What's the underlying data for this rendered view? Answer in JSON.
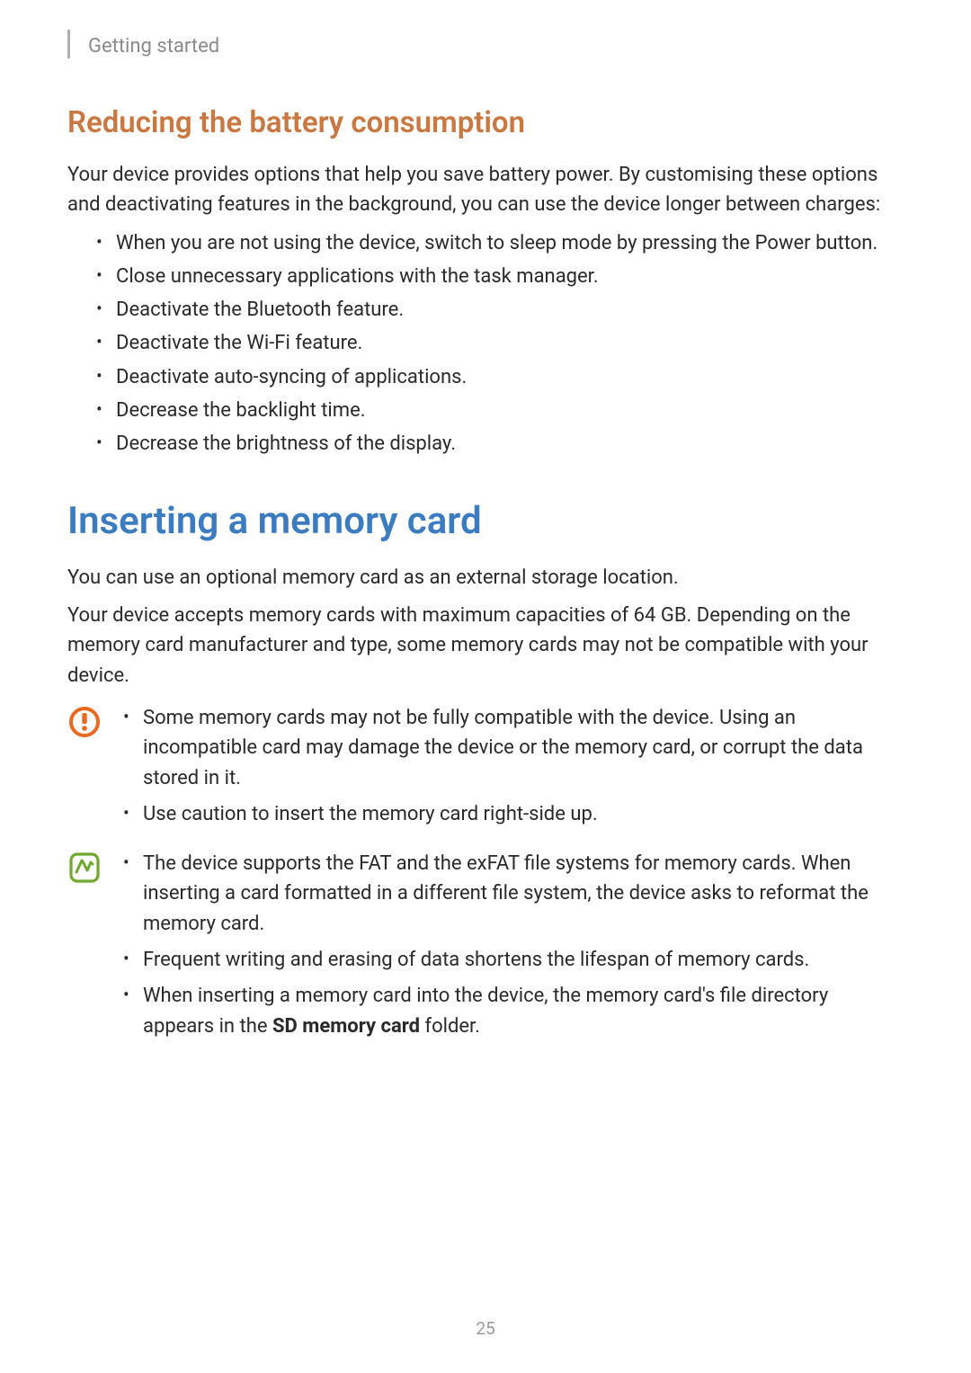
{
  "header": {
    "breadcrumb": "Getting started"
  },
  "section1": {
    "heading": "Reducing the battery consumption",
    "intro": "Your device provides options that help you save battery power. By customising these options and deactivating features in the background, you can use the device longer between charges:",
    "bullets": [
      "When you are not using the device, switch to sleep mode by pressing the Power button.",
      "Close unnecessary applications with the task manager.",
      "Deactivate the Bluetooth feature.",
      "Deactivate the Wi-Fi feature.",
      "Deactivate auto-syncing of applications.",
      "Decrease the backlight time.",
      "Decrease the brightness of the display."
    ]
  },
  "section2": {
    "heading": "Inserting a memory card",
    "p1": "You can use an optional memory card as an external storage location.",
    "p2": "Your device accepts memory cards with maximum capacities of 64 GB. Depending on the memory card manufacturer and type, some memory cards may not be compatible with your device.",
    "warning": {
      "bullets": [
        "Some memory cards may not be fully compatible with the device. Using an incompatible card may damage the device or the memory card, or corrupt the data stored in it.",
        "Use caution to insert the memory card right-side up."
      ]
    },
    "note": {
      "bullets_a": "The device supports the FAT and the exFAT file systems for memory cards. When inserting a card formatted in a different file system, the device asks to reformat the memory card.",
      "bullets_b": "Frequent writing and erasing of data shortens the lifespan of memory cards.",
      "bullets_c_pre": "When inserting a memory card into the device, the memory card's file directory appears in the ",
      "bullets_c_bold": "SD memory card",
      "bullets_c_post": " folder."
    }
  },
  "page_number": "25"
}
